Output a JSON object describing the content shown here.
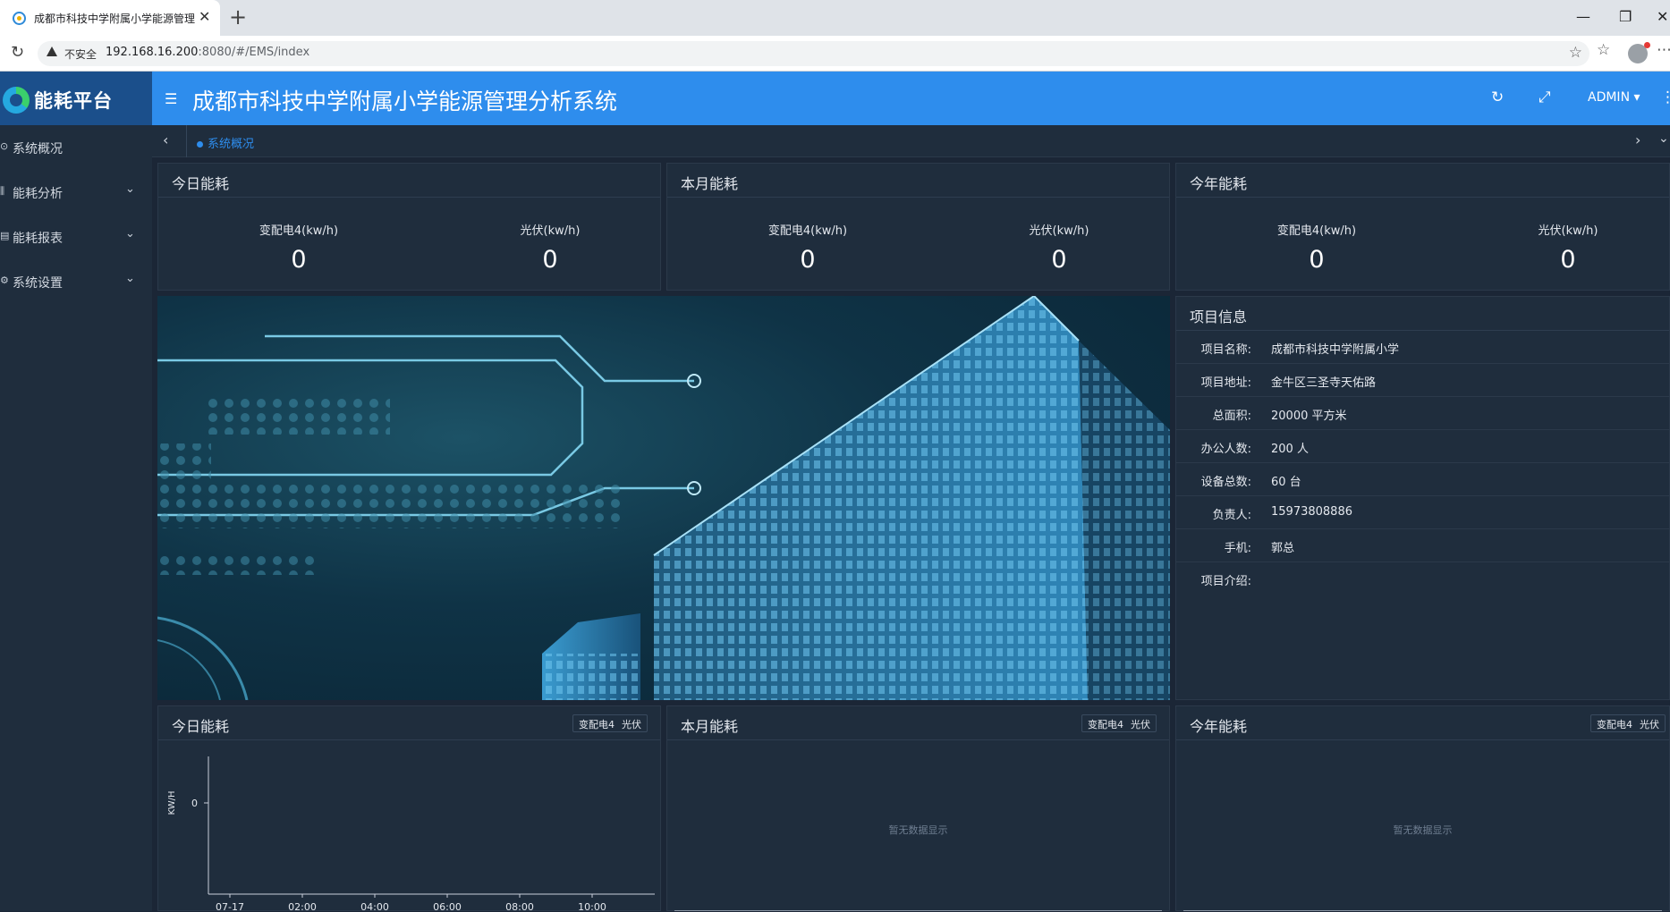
{
  "browser": {
    "tab_title": "成都市科技中学附属小学能源管理",
    "tab_close": "✕",
    "new_tab": "+",
    "minimize": "—",
    "restore": "❐",
    "close": "✕",
    "reload": "↻",
    "insecure_label": "不安全",
    "url_host": "192.168.16.200",
    "url_rest": ":8080/#/EMS/index",
    "star": "☆",
    "favorites": "☆",
    "menu": "⋯"
  },
  "app": {
    "logo_text": "能耗平台",
    "title": "成都市科技中学附属小学能源管理分析系统",
    "hamburger": "☰",
    "refresh_icon": "↻",
    "fullscreen_icon": "⤢",
    "user": "ADMIN ▾",
    "more": "⋮"
  },
  "sidebar": {
    "items": [
      {
        "icon": "⊙",
        "label": "系统概况",
        "chevron": ""
      },
      {
        "icon": "⫼",
        "label": "能耗分析",
        "chevron": "⌄"
      },
      {
        "icon": "▤",
        "label": "能耗报表",
        "chevron": "⌄"
      },
      {
        "icon": "⚙",
        "label": "系统设置",
        "chevron": "⌄"
      }
    ]
  },
  "breadcrumb": {
    "prev": "‹",
    "tag": "系统概况",
    "next": "›",
    "down": "⌄"
  },
  "energy_cards": [
    {
      "title": "今日能耗",
      "metrics": [
        {
          "label": "变配电4(kw/h)",
          "value": "0"
        },
        {
          "label": "光伏(kw/h)",
          "value": "0"
        }
      ]
    },
    {
      "title": "本月能耗",
      "metrics": [
        {
          "label": "变配电4(kw/h)",
          "value": "0"
        },
        {
          "label": "光伏(kw/h)",
          "value": "0"
        }
      ]
    },
    {
      "title": "今年能耗",
      "metrics": [
        {
          "label": "变配电4(kw/h)",
          "value": "0"
        },
        {
          "label": "光伏(kw/h)",
          "value": "0"
        }
      ]
    }
  ],
  "project_info": {
    "title": "项目信息",
    "rows": [
      {
        "key": "项目名称:",
        "value": "成都市科技中学附属小学"
      },
      {
        "key": "项目地址:",
        "value": "金牛区三圣寺天佑路"
      },
      {
        "key": "总面积:",
        "value": "20000 平方米"
      },
      {
        "key": "办公人数:",
        "value": "200 人"
      },
      {
        "key": "设备总数:",
        "value": "60 台"
      },
      {
        "key": "负责人:",
        "value": "15973808886"
      },
      {
        "key": "手机:",
        "value": "郭总"
      },
      {
        "key": "项目介绍:",
        "value": ""
      }
    ]
  },
  "charts": [
    {
      "title": "今日能耗",
      "legend": [
        "变配电4",
        "光伏"
      ],
      "empty_text": ""
    },
    {
      "title": "本月能耗",
      "legend": [
        "变配电4",
        "光伏"
      ],
      "empty_text": "暂无数据显示"
    },
    {
      "title": "今年能耗",
      "legend": [
        "变配电4",
        "光伏"
      ],
      "empty_text": "暂无数据显示"
    }
  ],
  "chart_data": {
    "type": "line",
    "x": [
      "07-17",
      "02:00",
      "04:00",
      "06:00",
      "08:00",
      "10:00"
    ],
    "ylabel": "KW/H",
    "y_ticks": [
      "0"
    ],
    "series": []
  }
}
